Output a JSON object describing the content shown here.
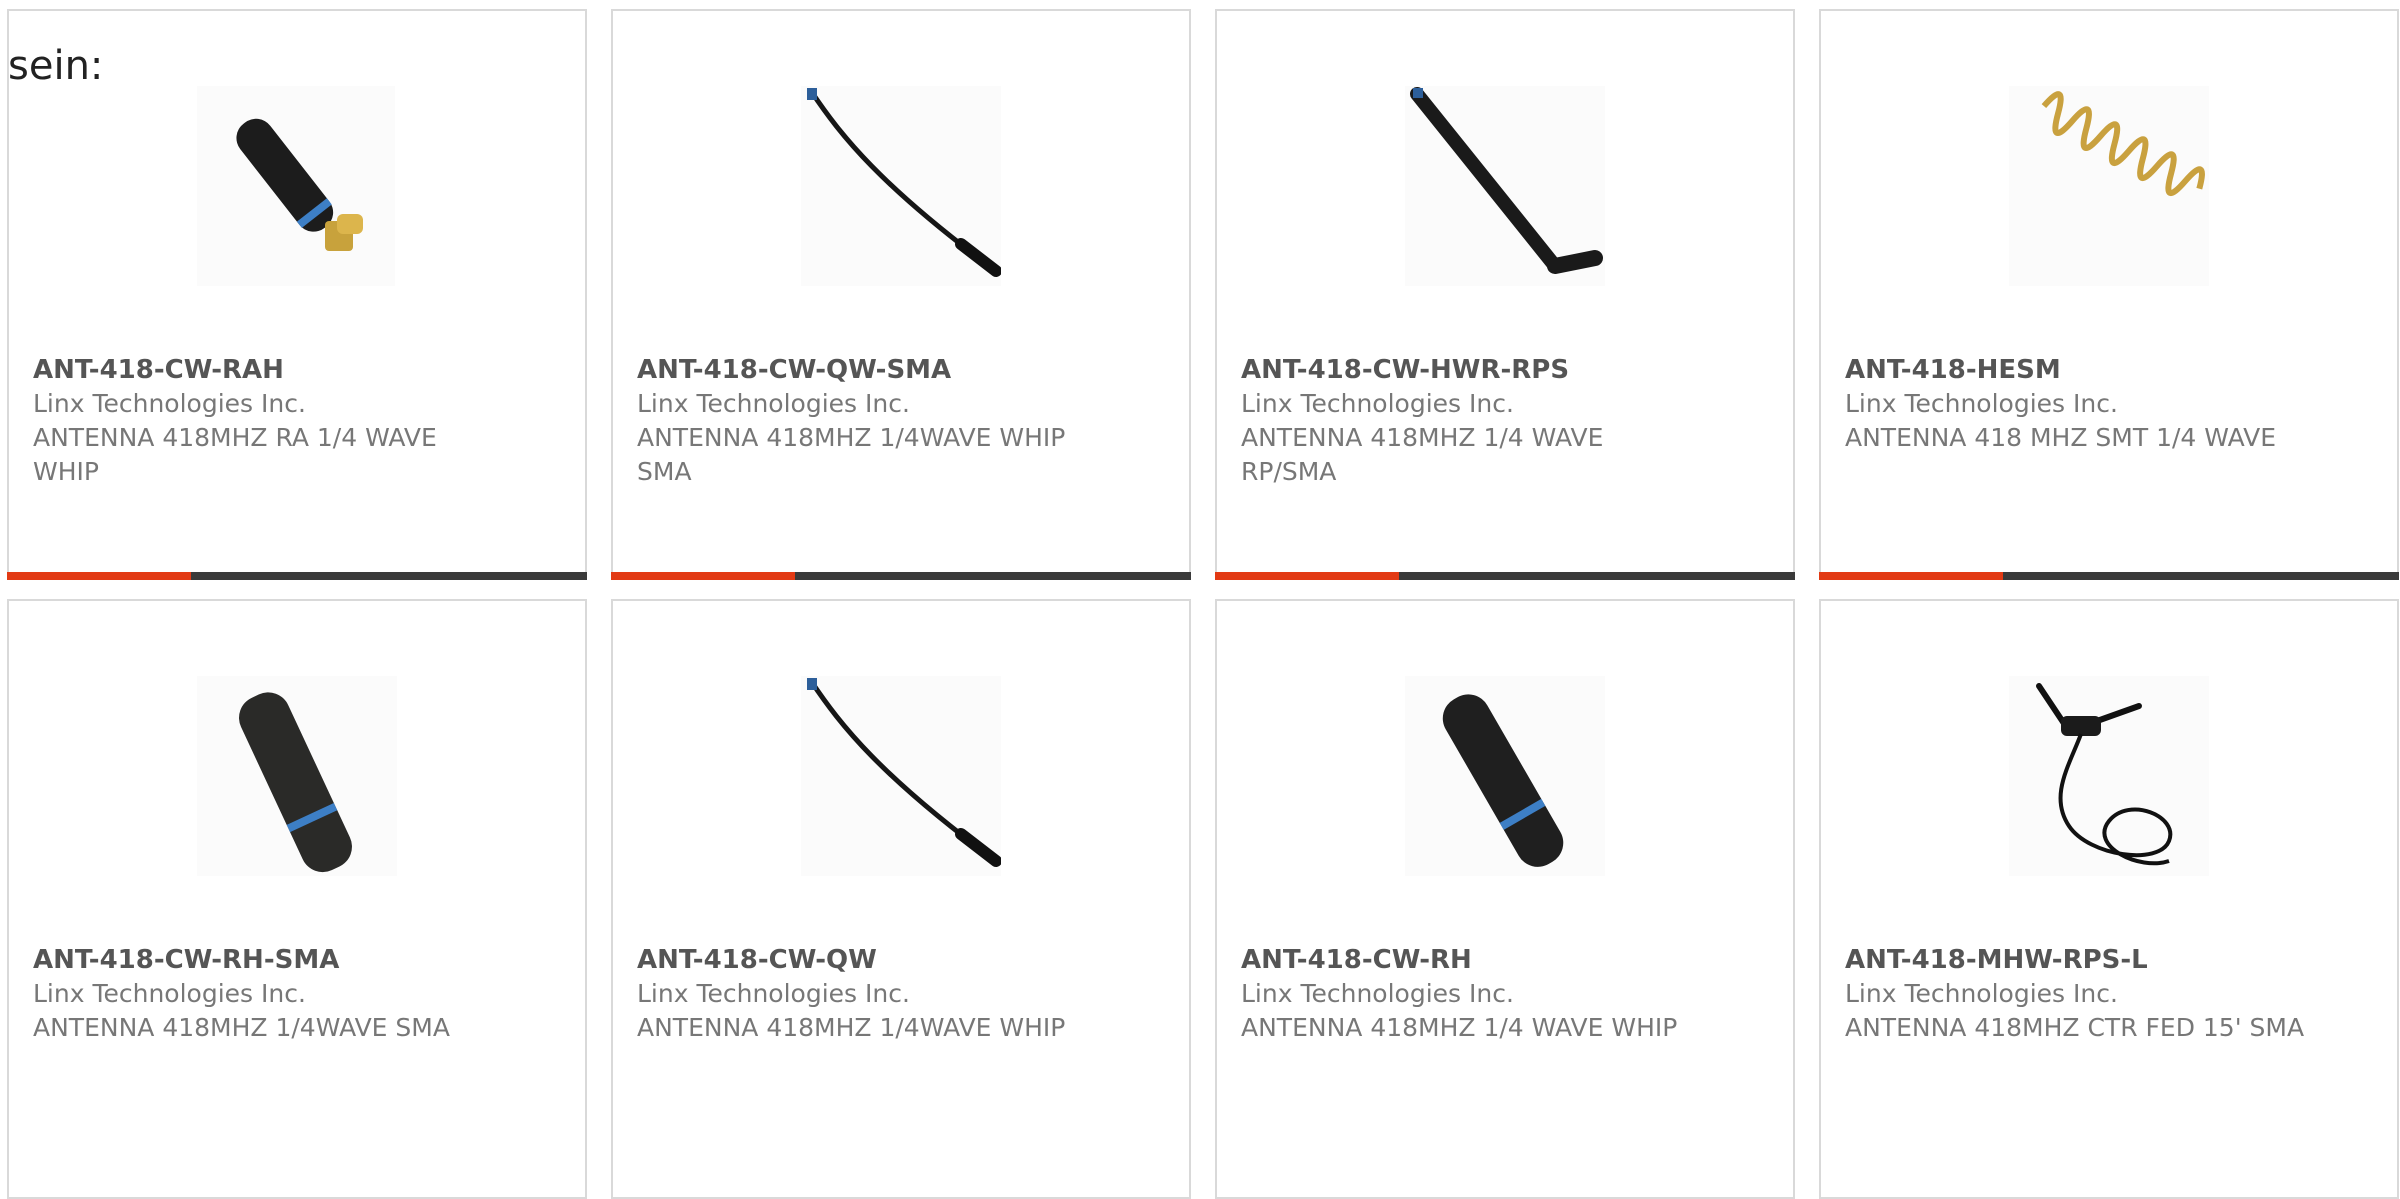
{
  "intro_text": "sein:",
  "colors": {
    "accent": "#e23a14",
    "bar_dark": "#3a3a3a",
    "border": "#d9d9d9"
  },
  "products": [
    {
      "part": "ANT-418-CW-RAH",
      "manufacturer": "Linx Technologies Inc.",
      "description": "ANTENNA 418MHZ RA 1/4 WAVE WHIP",
      "image": "antenna-right-angle-stubby"
    },
    {
      "part": "ANT-418-CW-QW-SMA",
      "manufacturer": "Linx Technologies Inc.",
      "description": "ANTENNA 418MHZ 1/4WAVE WHIP SMA",
      "image": "antenna-thin-whip"
    },
    {
      "part": "ANT-418-CW-HWR-RPS",
      "manufacturer": "Linx Technologies Inc.",
      "description": "ANTENNA 418MHZ 1/4 WAVE RP/SMA",
      "image": "antenna-hinged-whip"
    },
    {
      "part": "ANT-418-HESM",
      "manufacturer": "Linx Technologies Inc.",
      "description": "ANTENNA 418 MHZ SMT 1/4 WAVE",
      "image": "antenna-helical-coil"
    },
    {
      "part": "ANT-418-CW-RH-SMA",
      "manufacturer": "Linx Technologies Inc.",
      "description": "ANTENNA 418MHZ 1/4WAVE SMA",
      "image": "antenna-stubby"
    },
    {
      "part": "ANT-418-CW-QW",
      "manufacturer": "Linx Technologies Inc.",
      "description": "ANTENNA 418MHZ 1/4WAVE WHIP",
      "image": "antenna-thin-whip"
    },
    {
      "part": "ANT-418-CW-RH",
      "manufacturer": "Linx Technologies Inc.",
      "description": "ANTENNA 418MHZ 1/4 WAVE WHIP",
      "image": "antenna-stubby"
    },
    {
      "part": "ANT-418-MHW-RPS-L",
      "manufacturer": "Linx Technologies Inc.",
      "description": "ANTENNA 418MHZ CTR FED 15' SMA",
      "image": "antenna-cable-mount"
    }
  ]
}
